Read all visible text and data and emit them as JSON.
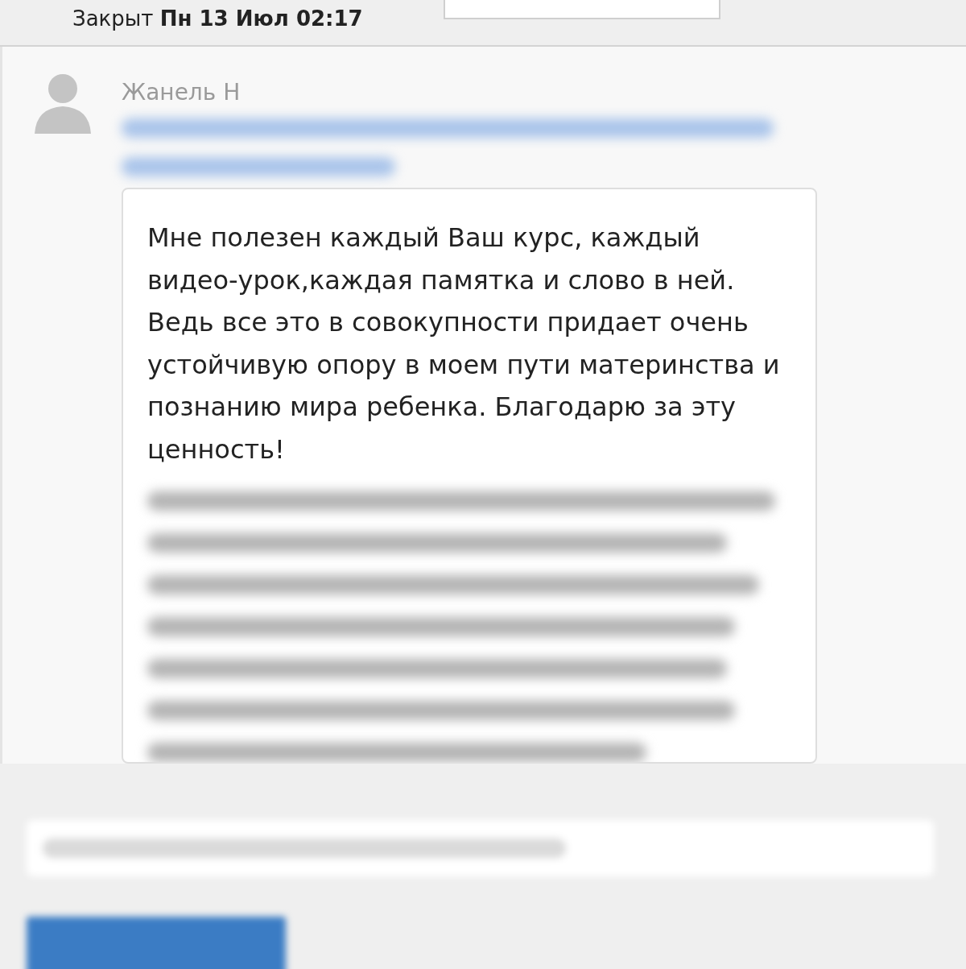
{
  "status_bar": {
    "text": "Закрыт **Пн 13 Июл 02:17**"
  },
  "message": {
    "author": "Жанель Н",
    "text": "Мне полезен каждый Ваш курс, каждый видео-урок,каждая памятка и слово в ней. Ведь все это в совокупности придает очень устойчивую опору в моем пути материнства и познанию мира ребенка. Благодарю за эту ценность!"
  }
}
